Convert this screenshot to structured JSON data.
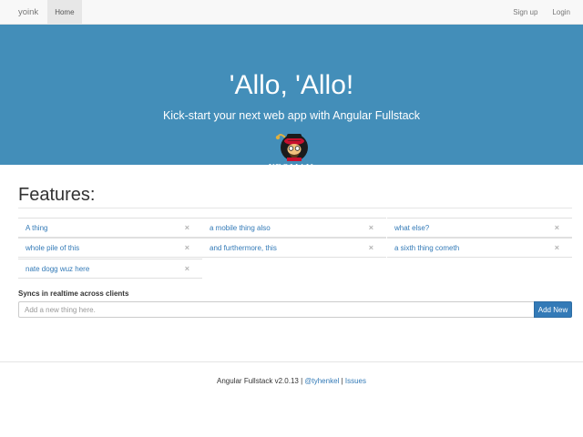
{
  "navbar": {
    "brand": "yoink",
    "home_label": "Home",
    "signup_label": "Sign up",
    "login_label": "Login"
  },
  "hero": {
    "title": "'Allo, 'Allo!",
    "subtitle": "Kick-start your next web app with Angular Fullstack",
    "logo_text": "YEOMAN",
    "background_color": "#438eb9"
  },
  "features": {
    "title": "Features:",
    "items": [
      {
        "label": "A thing"
      },
      {
        "label": "a mobile thing also"
      },
      {
        "label": "what else?"
      },
      {
        "label": "whole pile of this"
      },
      {
        "label": "and furthermore, this"
      },
      {
        "label": "a sixth thing cometh"
      },
      {
        "label": "nate dogg wuz here"
      }
    ],
    "remove_icon": "×"
  },
  "add_form": {
    "label": "Syncs in realtime across clients",
    "placeholder": "Add a new thing here.",
    "value": "",
    "button_label": "Add New",
    "button_color": "#337ab7"
  },
  "footer": {
    "text": "Angular Fullstack v2.0.13",
    "separator": "|",
    "twitter_label": "@tyhenkel",
    "issues_label": "Issues"
  }
}
